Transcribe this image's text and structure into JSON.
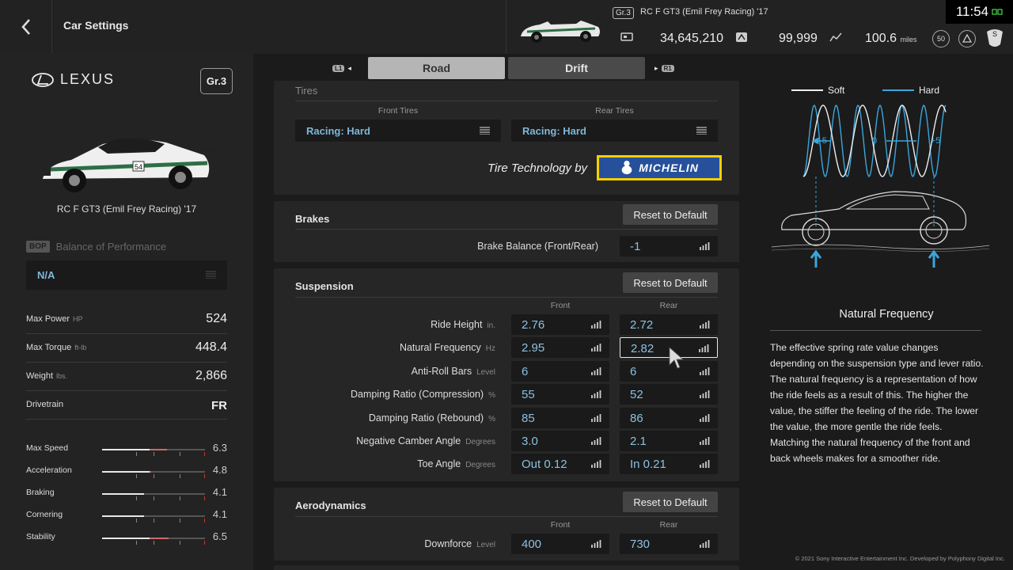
{
  "topbar": {
    "title": "Car Settings",
    "gr_badge": "Gr.3",
    "car_name": "RC F GT3 (Emil Frey Racing) '17",
    "credits": "34,645,210",
    "mileage_points": "99,999",
    "distance": "100.6",
    "distance_unit": "miles",
    "level": "50",
    "clock": "11:54"
  },
  "left": {
    "brand": "LEXUS",
    "group": "Gr.3",
    "car_name": "RC F GT3 (Emil Frey Racing) '17",
    "bop_tag": "BOP",
    "bop_label": "Balance of Performance",
    "bop_value": "N/A",
    "specs": [
      {
        "label": "Max Power",
        "unit": "HP",
        "value": "524"
      },
      {
        "label": "Max Torque",
        "unit": "ft-lb",
        "value": "448.4"
      },
      {
        "label": "Weight",
        "unit": "lbs.",
        "value": "2,866"
      },
      {
        "label": "Drivetrain",
        "unit": "",
        "value": "FR"
      }
    ],
    "ratings": [
      {
        "label": "Max Speed",
        "value": "6.3",
        "fraction": 0.63
      },
      {
        "label": "Acceleration",
        "value": "4.8",
        "fraction": 0.48
      },
      {
        "label": "Braking",
        "value": "4.1",
        "fraction": 0.41
      },
      {
        "label": "Cornering",
        "value": "4.1",
        "fraction": 0.41
      },
      {
        "label": "Stability",
        "value": "6.5",
        "fraction": 0.65
      }
    ]
  },
  "tabs": {
    "left_button": "L1",
    "right_button": "R1",
    "road": "Road",
    "drift": "Drift"
  },
  "tires": {
    "title": "Tires",
    "front_header": "Front Tires",
    "rear_header": "Rear Tires",
    "front_value": "Racing: Hard",
    "rear_value": "Racing: Hard",
    "tech_by": "Tire Technology by",
    "brand": "MICHELIN"
  },
  "brakes": {
    "title": "Brakes",
    "reset": "Reset to Default",
    "balance_label": "Brake Balance (Front/Rear)",
    "balance_value": "-1"
  },
  "suspension": {
    "title": "Suspension",
    "reset": "Reset to Default",
    "front_header": "Front",
    "rear_header": "Rear",
    "rows": [
      {
        "label": "Ride Height",
        "unit": "in.",
        "front": "2.76",
        "rear": "2.72"
      },
      {
        "label": "Natural Frequency",
        "unit": "Hz",
        "front": "2.95",
        "rear": "2.82"
      },
      {
        "label": "Anti-Roll Bars",
        "unit": "Level",
        "front": "6",
        "rear": "6"
      },
      {
        "label": "Damping Ratio (Compression)",
        "unit": "%",
        "front": "55",
        "rear": "52"
      },
      {
        "label": "Damping Ratio (Rebound)",
        "unit": "%",
        "front": "85",
        "rear": "86"
      },
      {
        "label": "Negative Camber Angle",
        "unit": "Degrees",
        "front": "3.0",
        "rear": "2.1"
      },
      {
        "label": "Toe Angle",
        "unit": "Degrees",
        "front": "Out 0.12",
        "rear": "In 0.21"
      }
    ]
  },
  "aero": {
    "title": "Aerodynamics",
    "reset": "Reset to Default",
    "front_header": "Front",
    "rear_header": "Rear",
    "downforce_label": "Downforce",
    "downforce_unit": "Level",
    "front": "400",
    "rear": "730"
  },
  "info": {
    "legend_soft": "Soft",
    "legend_hard": "Hard",
    "axis_left": "-5",
    "axis_mid": "0",
    "axis_right": "+5",
    "title": "Natural Frequency",
    "text": "The effective spring rate value changes depending on the suspension type and lever ratio. The natural frequency is a representation of how the ride feels as a result of this. The higher the value, the stiffer the feeling of the ride. The lower the value, the more gentle the ride feels. Matching the natural frequency of the front and back wheels makes for a smoother ride.",
    "copyright": "© 2021 Sony Interactive Entertainment Inc. Developed by Polyphony Digital Inc."
  },
  "colors": {
    "accent_blue": "#7fb7d9",
    "hard_wave": "#3aa6dc",
    "rating_red": "#c96b6b"
  }
}
